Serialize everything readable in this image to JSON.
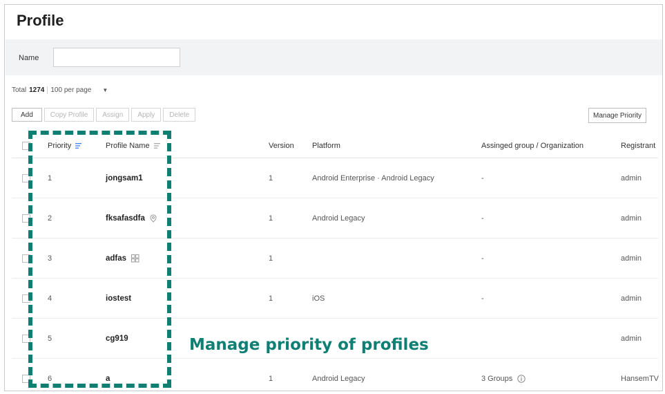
{
  "page": {
    "title": "Profile"
  },
  "search": {
    "name_label": "Name",
    "name_value": "",
    "name_placeholder": ""
  },
  "pager": {
    "total_label": "Total",
    "total_count": "1274",
    "per_page": "100 per page"
  },
  "toolbar": {
    "add": "Add",
    "copy_profile": "Copy Profile",
    "assign": "Assign",
    "apply": "Apply",
    "delete": "Delete",
    "manage_priority": "Manage Priority"
  },
  "table": {
    "headers": {
      "priority": "Priority",
      "profile_name": "Profile Name",
      "version": "Version",
      "platform": "Platform",
      "group": "Assinged group / Organization",
      "registrant": "Registrant"
    },
    "rows": [
      {
        "priority": "1",
        "name": "jongsam1",
        "version": "1",
        "platform": "Android Enterprise · Android Legacy",
        "group": "-",
        "registrant": "admin"
      },
      {
        "priority": "2",
        "name": "fksafasdfa",
        "version": "1",
        "platform": "Android Legacy",
        "group": "-",
        "registrant": "admin"
      },
      {
        "priority": "3",
        "name": "adfas",
        "version": "1",
        "platform": "",
        "group": "-",
        "registrant": "admin"
      },
      {
        "priority": "4",
        "name": "iostest",
        "version": "1",
        "platform": "iOS",
        "group": "-",
        "registrant": "admin"
      },
      {
        "priority": "5",
        "name": "cg919",
        "version": "",
        "platform": "",
        "group": "",
        "registrant": "admin"
      },
      {
        "priority": "6",
        "name": "a",
        "version": "1",
        "platform": "Android Legacy",
        "group": "3 Groups",
        "registrant": "HansemTV"
      }
    ]
  },
  "annotation": {
    "callout": "Manage priority of profiles"
  },
  "colors": {
    "accent": "#0f7f73",
    "sort_icon": "#3b82f6"
  }
}
